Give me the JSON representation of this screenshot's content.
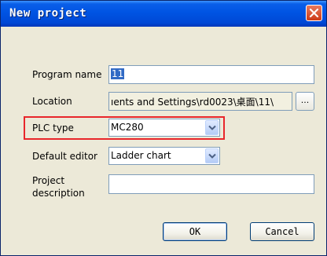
{
  "dialog": {
    "title": "New project",
    "close_glyph": "✕"
  },
  "form": {
    "program_name": {
      "label": "Program name",
      "value": "11"
    },
    "location": {
      "label": "Location",
      "value": "ıents and Settings\\rd0023\\桌面\\11\\",
      "browse_label": "..."
    },
    "plc_type": {
      "label": "PLC type",
      "value": "MC280"
    },
    "default_editor": {
      "label": "Default editor",
      "value": "Ladder chart"
    },
    "project_description": {
      "label_line1": "Project",
      "label_line2": "description",
      "value": ""
    }
  },
  "buttons": {
    "ok": "OK",
    "cancel": "Cancel"
  },
  "colors": {
    "titlebar": "#0054e3",
    "highlight": "#e8262b",
    "dialog_bg": "#ece9d8"
  },
  "icons": {
    "close": "close-icon",
    "dropdown": "chevron-down-icon"
  }
}
